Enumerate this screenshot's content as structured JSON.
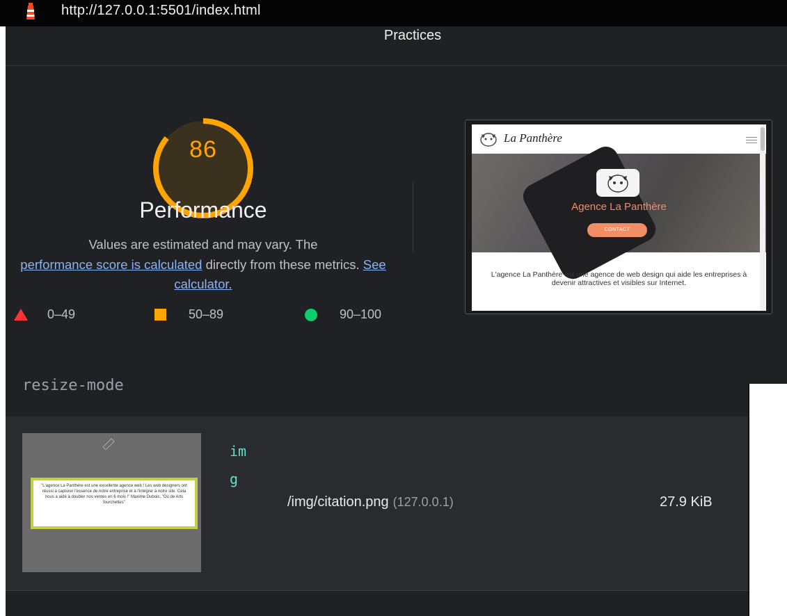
{
  "urlbar": {
    "icon": "lighthouse-icon",
    "url": "http://127.0.0.1:5501/index.html"
  },
  "header": {
    "category_fragment": "Practices"
  },
  "score": {
    "value": "86",
    "fraction": 0.86,
    "color": "#ffa400",
    "title": "Performance",
    "desc_prefix": "Values are estimated and may vary. The",
    "desc_link1": "performance score is calculated",
    "desc_middle": "directly from these metrics.",
    "desc_link2": "See calculator."
  },
  "legend": [
    {
      "icon": "triangle-icon",
      "label": "0–49",
      "color": "#ff3333"
    },
    {
      "icon": "square-icon",
      "label": "50–89",
      "color": "#ffa400"
    },
    {
      "icon": "circle-icon",
      "label": "90–100",
      "color": "#0cce6b"
    }
  ],
  "screenshot": {
    "brand": "La Panthère",
    "hero_title": "Agence La Panthère",
    "hero_button": "CONTACT",
    "body_text": "L'agence La Panthère est une agence de web design qui aide les entreprises à devenir attractives et visibles sur Internet."
  },
  "details": {
    "code_label": "resize-mode",
    "row": {
      "type": "img",
      "url": "/img/citation.png",
      "host": "(127.0.0.1)",
      "size": "27.9 KiB",
      "quote_text": "\"L'agence La Panthère est une excellente agence web ! Les web designers ont réussi à capturer l'essence de notre entreprise et à l'intégrer à notre site. Cela nous a aidé à doubler nos ventes en 6 mois !\" Maxime Dubois, \"Où de Arts fourchettes\""
    }
  }
}
